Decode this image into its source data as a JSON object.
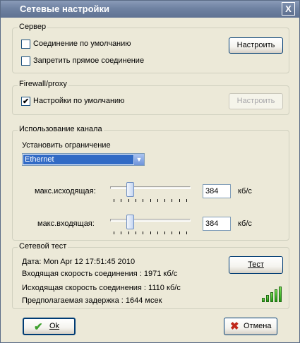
{
  "window": {
    "title": "Сетевые настройки",
    "close_glyph": "X"
  },
  "server": {
    "label": "Сервер",
    "default_connection": {
      "label": "Соединение по умолчанию",
      "checked": false
    },
    "block_direct": {
      "label": "Запретить прямое соединение",
      "checked": false
    },
    "configure_label": "Настроить"
  },
  "firewall": {
    "label": "Firewall/proxy",
    "default_settings": {
      "label": "Настройки по умолчанию",
      "checked": true,
      "check_glyph": "✔"
    },
    "configure_label": "Настроить",
    "configure_enabled": false
  },
  "bandwidth": {
    "label": "Использование канала",
    "limit_label": "Установить ограничение",
    "limit_value": "Ethernet",
    "upload_label": "макс.исходящая:",
    "upload_value": "384",
    "upload_level": 0.22,
    "download_label": "макс.входящая:",
    "download_value": "384",
    "download_level": 0.22,
    "unit": "кб/с"
  },
  "network_test": {
    "label": "Сетевой тест",
    "date": "Дата:  Mon Apr 12 17:51:45 2010",
    "incoming_speed": "Входящая скорость соединения : 1971 кб/с",
    "outgoing_speed": "Исходящая скорость соединения : 1110 кб/с",
    "latency": "Предполагаемая задержка : 1644 мсек",
    "test_label": "Тест",
    "signal_icon": "signal-strength-icon",
    "signal_bars": 5
  },
  "footer": {
    "ok_label": "Ok",
    "ok_icon": "checkmark-icon",
    "cancel_label": "Отмена",
    "cancel_icon": "cross-icon"
  },
  "colors": {
    "titlebar": "#6f82a2",
    "dialog_bg": "#ece9d8",
    "selection": "#316ac5",
    "ok_check": "#3da02d",
    "cancel_cross": "#c0281a"
  }
}
